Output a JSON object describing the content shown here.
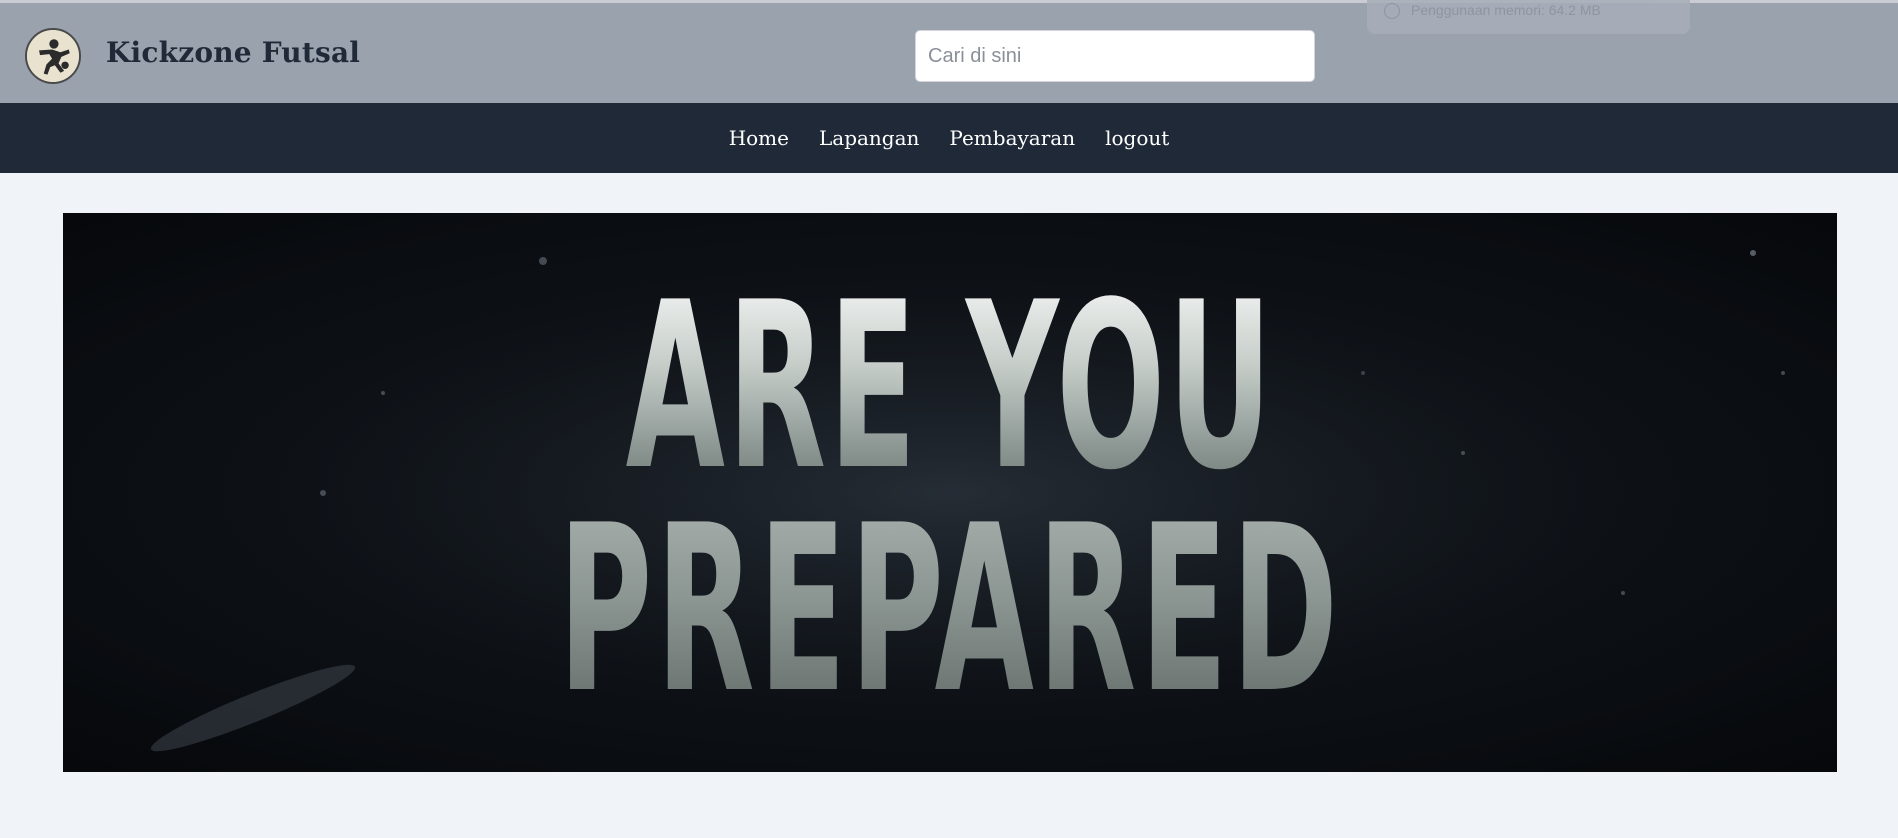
{
  "header": {
    "brand": "Kickzone Futsal",
    "logo_icon": "soccer-player-icon",
    "search": {
      "placeholder": "Cari di sini",
      "value": ""
    },
    "memory_overlay": {
      "icon": "gauge-icon",
      "text": "Penggunaan memori: 64.2 MB"
    }
  },
  "nav": {
    "items": [
      {
        "label": "Home"
      },
      {
        "label": "Lapangan"
      },
      {
        "label": "Pembayaran"
      },
      {
        "label": "logout"
      }
    ]
  },
  "banner": {
    "line1": "ARE YOU",
    "line2": "PREPARED"
  },
  "colors": {
    "header_bg": "#9aa2ae",
    "nav_bg": "#1f2937",
    "page_bg": "#f0f4f8",
    "brand_text": "#1f2937"
  }
}
